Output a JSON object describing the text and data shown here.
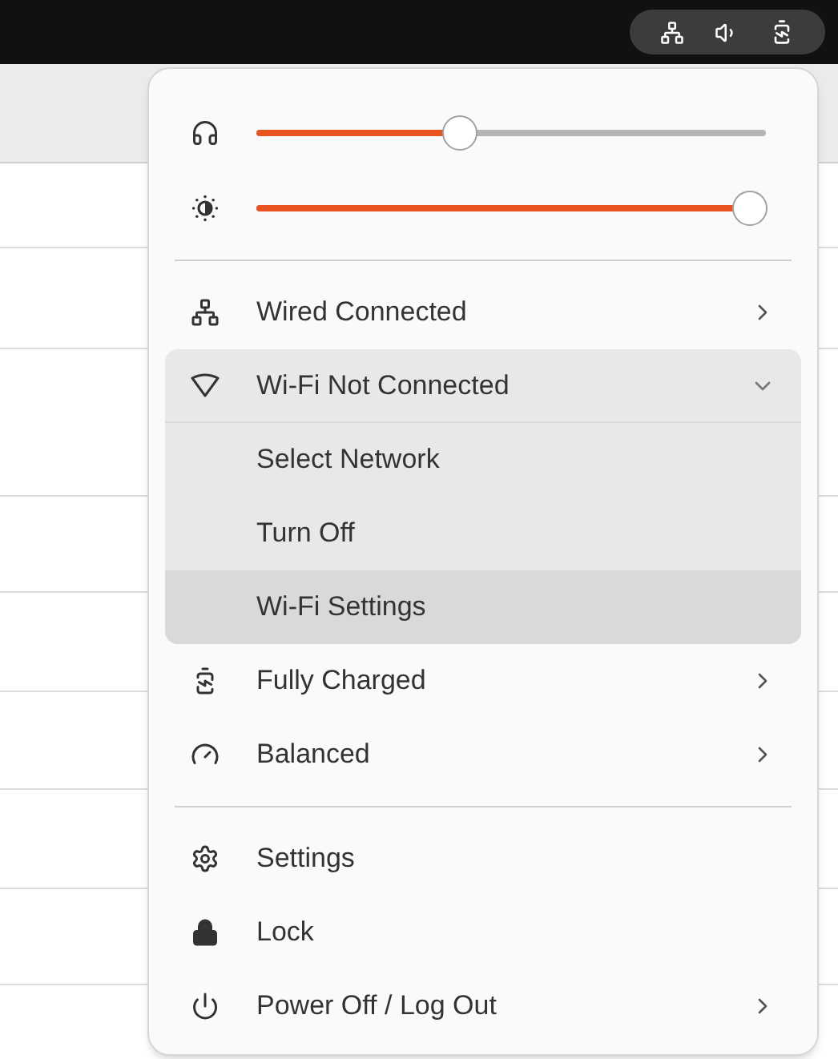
{
  "sliders": [
    {
      "level": 0.4
    },
    {
      "level": 0.97
    }
  ],
  "menu_items": [
    {
      "kind": "submenu",
      "label": "Wired Connected"
    },
    {
      "kind": "expander",
      "label": "Wi-Fi Not Connected",
      "expanded": true,
      "children": [
        {
          "label": "Select Network",
          "selected": false
        },
        {
          "label": "Turn Off",
          "selected": false
        },
        {
          "label": "Wi-Fi Settings",
          "selected": true
        }
      ]
    },
    {
      "kind": "submenu",
      "label": "Fully Charged"
    },
    {
      "kind": "submenu",
      "label": "Balanced"
    }
  ],
  "system_items": [
    {
      "kind": "action",
      "label": "Settings"
    },
    {
      "kind": "action",
      "label": "Lock"
    },
    {
      "kind": "submenu",
      "label": "Power Off / Log Out"
    }
  ]
}
